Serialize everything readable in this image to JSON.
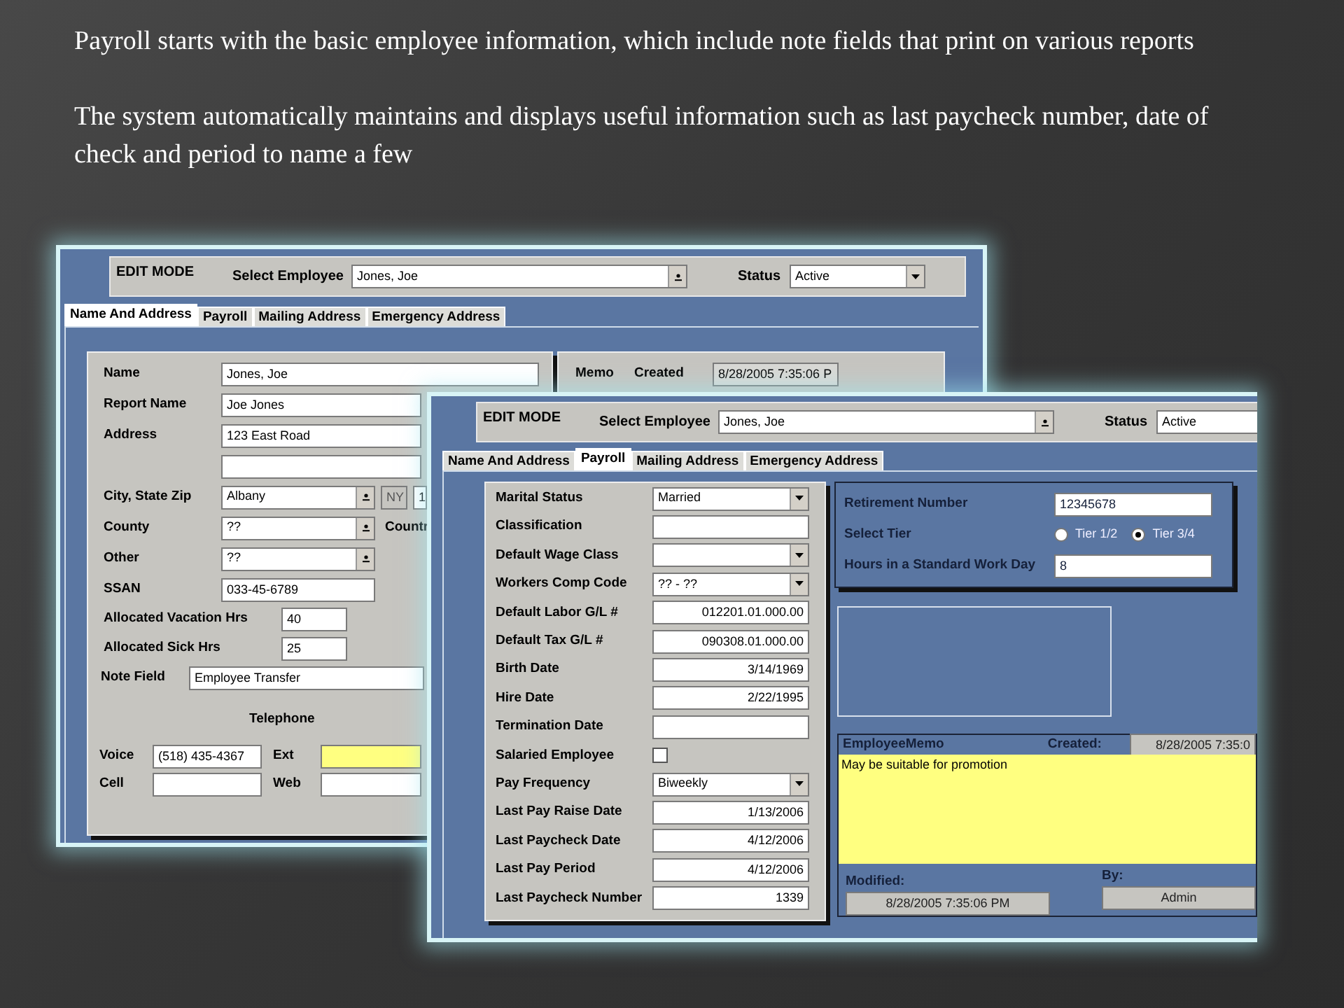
{
  "slide_text": [
    "Payroll starts with the basic employee information, which include note fields that print on various reports",
    "The system automatically maintains and displays useful information such as last paycheck number, date of check and period to name a few"
  ],
  "name_and_address_window": {
    "header": {
      "mode": "EDIT MODE",
      "employee_label": "Select Employee",
      "employee": "Jones, Joe",
      "status_label": "Status",
      "status": "Active"
    },
    "tabs": [
      {
        "label": "Name And Address",
        "selected": true
      },
      {
        "label": "Payroll",
        "selected": false
      },
      {
        "label": "Mailing Address",
        "selected": false
      },
      {
        "label": "Emergency Address",
        "selected": false
      }
    ],
    "fields": [
      {
        "kind": "wide",
        "label": "Name",
        "value": "Jones, Joe"
      },
      {
        "kind": "wide",
        "label": "Report Name",
        "value": "Joe Jones"
      },
      {
        "kind": "wide",
        "label": "Address",
        "value": "123 East Road"
      },
      {
        "kind": "wide"
      },
      {
        "kind": "city",
        "label": "City, State Zip",
        "value": "Albany",
        "state": "NY",
        "zip": "1"
      },
      {
        "kind": "combo",
        "label": "County",
        "value": "??",
        "aside": "Countr"
      },
      {
        "kind": "combo",
        "label": "Other",
        "value": "??"
      },
      {
        "kind": "text",
        "label": "SSAN",
        "value": "033-45-6789"
      },
      {
        "kind": "short",
        "label": "Allocated Vacation Hrs",
        "value": "40"
      },
      {
        "kind": "short",
        "label": "Allocated Sick Hrs",
        "value": "25"
      },
      {
        "kind": "note",
        "label": "Note Field",
        "value": "Employee Transfer"
      }
    ],
    "telephone": {
      "title": "Telephone",
      "voice_label": "Voice",
      "voice": "(518) 435-4367",
      "ext_label": "Ext",
      "cell_label": "Cell",
      "web_label": "Web"
    },
    "memo": {
      "label": "Memo",
      "created_label": "Created",
      "created": "8/28/2005 7:35:06 P"
    }
  },
  "payroll_window": {
    "header": {
      "mode": "EDIT MODE",
      "employee_label": "Select Employee",
      "employee": "Jones, Joe",
      "status_label": "Status",
      "status": "Active"
    },
    "tabs": [
      {
        "label": "Name And Address",
        "selected": false
      },
      {
        "label": "Payroll",
        "selected": true
      },
      {
        "label": "Mailing Address",
        "selected": false
      },
      {
        "label": "Emergency Address",
        "selected": false
      }
    ],
    "fields": [
      {
        "kind": "combo",
        "label": "Marital Status",
        "value": "Married"
      },
      {
        "kind": "text",
        "label": "Classification"
      },
      {
        "kind": "combo",
        "label": "Default Wage Class"
      },
      {
        "kind": "combo",
        "label": "Workers Comp Code",
        "value": "?? - ??"
      },
      {
        "kind": "number",
        "label": "Default Labor G/L #",
        "value": "012201.01.000.00"
      },
      {
        "kind": "number",
        "label": "Default Tax G/L #",
        "value": "090308.01.000.00"
      },
      {
        "kind": "number",
        "label": "Birth Date",
        "value": "3/14/1969"
      },
      {
        "kind": "number",
        "label": "Hire Date",
        "value": "2/22/1995"
      },
      {
        "kind": "text",
        "label": "Termination Date"
      },
      {
        "kind": "checkbox",
        "label": "Salaried Employee",
        "checked": false
      },
      {
        "kind": "combo",
        "label": "Pay Frequency",
        "value": "Biweekly"
      },
      {
        "kind": "number",
        "label": "Last Pay Raise Date",
        "value": "1/13/2006"
      },
      {
        "kind": "number",
        "label": "Last Paycheck Date",
        "value": "4/12/2006"
      },
      {
        "kind": "number",
        "label": "Last Pay Period",
        "value": "4/12/2006"
      },
      {
        "kind": "number",
        "label": "Last Paycheck Number",
        "value": "1339"
      }
    ],
    "retirement": {
      "number_label": "Retirement Number",
      "number": "12345678",
      "tier_label": "Select Tier",
      "tiers": [
        {
          "label": "Tier 1/2",
          "selected": false
        },
        {
          "label": "Tier 3/4",
          "selected": true
        }
      ],
      "hours_label": "Hours in a Standard Work Day",
      "hours": "8"
    },
    "memo": {
      "title": "EmployeeMemo",
      "created_label": "Created:",
      "created": "8/28/2005 7:35:0",
      "text": "May be suitable for promotion",
      "modified_label": "Modified:",
      "modified": "8/28/2005 7:35:06 PM",
      "by_label": "By:",
      "by": "Admin"
    }
  }
}
